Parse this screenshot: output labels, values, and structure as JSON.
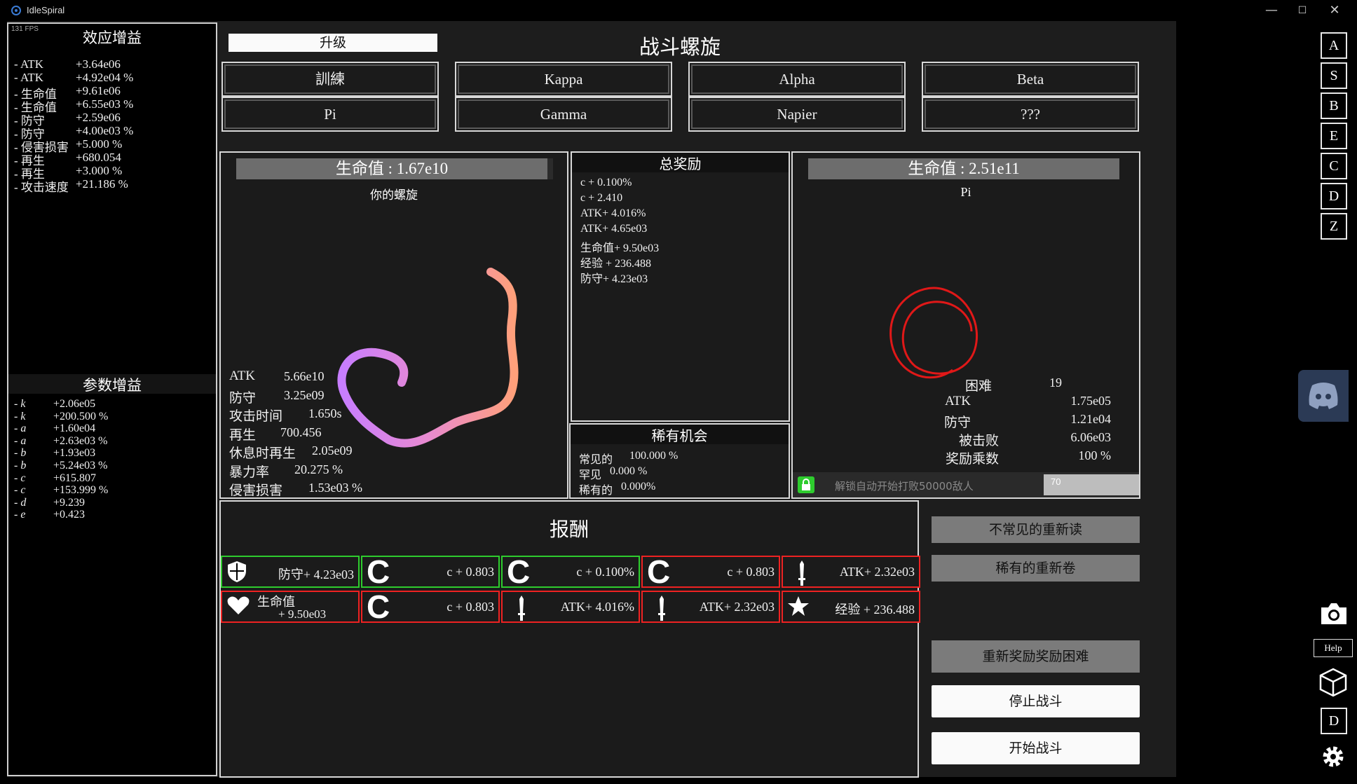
{
  "window": {
    "title": "IdleSpiral",
    "minimize": "—",
    "maximize": "☐",
    "close": "✕"
  },
  "fps": "131 FPS",
  "effects": {
    "title": "效应增益",
    "items": [
      {
        "name": "- ATK",
        "value": "+3.64e06"
      },
      {
        "name": "- ATK",
        "value": "+4.92e04 %"
      },
      {
        "name": "- 生命值",
        "value": "+9.61e06"
      },
      {
        "name": "- 生命值",
        "value": "+6.55e03 %"
      },
      {
        "name": "- 防守",
        "value": "+2.59e06"
      },
      {
        "name": "- 防守",
        "value": "+4.00e03 %"
      },
      {
        "name": "- 侵害损害",
        "value": "+5.000 %"
      },
      {
        "name": "- 再生",
        "value": "+680.054"
      },
      {
        "name": "- 再生",
        "value": "+3.000 %"
      },
      {
        "name": "- 攻击速度",
        "value": "+21.186 %"
      }
    ]
  },
  "params": {
    "title": "参数增益",
    "items": [
      {
        "name": "- k",
        "value": "+2.06e05"
      },
      {
        "name": "- k",
        "value": "+200.500 %"
      },
      {
        "name": "- a",
        "value": "+1.60e04"
      },
      {
        "name": "- a",
        "value": "+2.63e03 %"
      },
      {
        "name": "- b",
        "value": "+1.93e03"
      },
      {
        "name": "- b",
        "value": "+5.24e03 %"
      },
      {
        "name": "- c",
        "value": "+615.807"
      },
      {
        "name": "- c",
        "value": "+153.999 %"
      },
      {
        "name": "- d",
        "value": "+9.239"
      },
      {
        "name": "- e",
        "value": "+0.423"
      }
    ]
  },
  "header": {
    "upgrade": "升级",
    "title": "战斗螺旋"
  },
  "tabs": [
    "訓練",
    "Kappa",
    "Alpha",
    "Beta",
    "Pi",
    "Gamma",
    "Napier",
    "???"
  ],
  "player": {
    "hp": "生命值 : 1.67e10",
    "name": "你的螺旋",
    "stats": [
      {
        "k": "ATK",
        "v": "5.66e10"
      },
      {
        "k": "防守",
        "v": "3.25e09"
      },
      {
        "k": "攻击时间",
        "v": "1.650s"
      },
      {
        "k": "再生",
        "v": "700.456"
      },
      {
        "k": "休息时再生",
        "v": "2.05e09"
      },
      {
        "k": "暴力率",
        "v": "20.275 %"
      },
      {
        "k": "侵害损害",
        "v": "1.53e03 %"
      }
    ]
  },
  "total_rewards": {
    "title": "总奖励",
    "items": [
      "c + 0.100%",
      "c + 2.410",
      "ATK+ 4.016%",
      "ATK+ 4.65e03",
      "生命值+ 9.50e03",
      "经验 + 236.488",
      "防守+ 4.23e03"
    ]
  },
  "rare_chance": {
    "title": "稀有机会",
    "items": [
      {
        "k": "常见的",
        "v": "100.000 %"
      },
      {
        "k": "罕见",
        "v": "0.000 %"
      },
      {
        "k": "稀有的",
        "v": "0.000%"
      }
    ]
  },
  "enemy": {
    "hp": "生命值 : 2.51e11",
    "name": "Pi",
    "stats": [
      {
        "k": "困难",
        "v": "19"
      },
      {
        "k": "ATK",
        "v": "1.75e05"
      },
      {
        "k": "防守",
        "v": "1.21e04"
      },
      {
        "k": "被击败",
        "v": "6.06e03"
      },
      {
        "k": "奖励乘数",
        "v": "100 %"
      }
    ],
    "lock_text": "解锁自动开始打败50000敌人",
    "auto_input": "70"
  },
  "rewards": {
    "title": "报酬",
    "items": [
      {
        "icon": "shield",
        "text": "防守+ 4.23e03",
        "color": "green"
      },
      {
        "icon": "c",
        "text": "c + 0.803",
        "color": "green"
      },
      {
        "icon": "c",
        "text": "c + 0.100%",
        "color": "green"
      },
      {
        "icon": "c",
        "text": "c + 0.803",
        "color": "red"
      },
      {
        "icon": "sword",
        "text": "ATK+ 2.32e03",
        "color": "red"
      },
      {
        "icon": "heart",
        "text": "生命值",
        "text2": "+ 9.50e03",
        "color": "red"
      },
      {
        "icon": "c",
        "text": "c + 0.803",
        "color": "red"
      },
      {
        "icon": "sword",
        "text": "ATK+ 4.016%",
        "color": "red"
      },
      {
        "icon": "sword",
        "text": "ATK+ 2.32e03",
        "color": "red"
      },
      {
        "icon": "star",
        "text": "经验 + 236.488",
        "color": "red"
      }
    ]
  },
  "actions": {
    "reroll_uncommon": "不常见的重新读",
    "reroll_rare": "稀有的重新卷",
    "reward_difficulty": "重新奖励奖励困难",
    "stop_battle": "停止战斗",
    "start_battle": "开始战斗"
  },
  "sidebar": {
    "buttons": [
      "A",
      "S",
      "B",
      "E",
      "C",
      "D",
      "Z"
    ],
    "help": "Help",
    "d_button": "D"
  },
  "colors": {
    "accent_green": "#2ecc2e",
    "accent_red": "#e22222",
    "player_spiral_start": "#c77dff",
    "player_spiral_end": "#ffa07a",
    "enemy_spiral": "#e01818",
    "discord": "#2b3a55"
  }
}
